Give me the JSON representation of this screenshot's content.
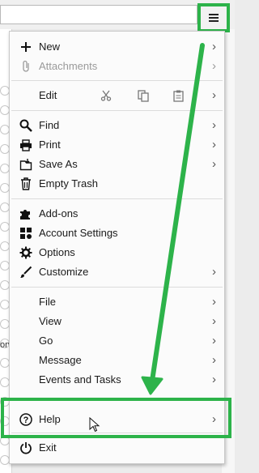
{
  "menu": {
    "items": [
      {
        "label": "New",
        "icon": "plus-icon",
        "submenu": true
      },
      {
        "label": "Attachments",
        "icon": "paperclip-icon",
        "submenu": true,
        "disabled": true
      },
      {
        "label": "Edit",
        "icon": "",
        "submenu": true
      },
      {
        "label": "Find",
        "icon": "search-icon",
        "submenu": true
      },
      {
        "label": "Print",
        "icon": "printer-icon",
        "submenu": true
      },
      {
        "label": "Save As",
        "icon": "save-icon",
        "submenu": true
      },
      {
        "label": "Empty Trash",
        "icon": "trash-icon",
        "submenu": false
      },
      {
        "label": "Add-ons",
        "icon": "puzzle-icon",
        "submenu": false
      },
      {
        "label": "Account Settings",
        "icon": "account-settings-icon",
        "submenu": false
      },
      {
        "label": "Options",
        "icon": "gear-icon",
        "submenu": false
      },
      {
        "label": "Customize",
        "icon": "brush-icon",
        "submenu": true
      },
      {
        "label": "File",
        "icon": "",
        "submenu": true
      },
      {
        "label": "View",
        "icon": "",
        "submenu": true
      },
      {
        "label": "Go",
        "icon": "",
        "submenu": true
      },
      {
        "label": "Message",
        "icon": "",
        "submenu": true
      },
      {
        "label": "Events and Tasks",
        "icon": "",
        "submenu": true
      },
      {
        "label": "Help",
        "icon": "help-circle-icon",
        "submenu": true
      },
      {
        "label": "Exit",
        "icon": "power-icon",
        "submenu": false
      }
    ],
    "edit_tools": [
      "cut-icon",
      "copy-icon",
      "paste-icon"
    ]
  },
  "background": {
    "fragment_text": "orv"
  },
  "colors": {
    "highlight": "#2db34a"
  }
}
